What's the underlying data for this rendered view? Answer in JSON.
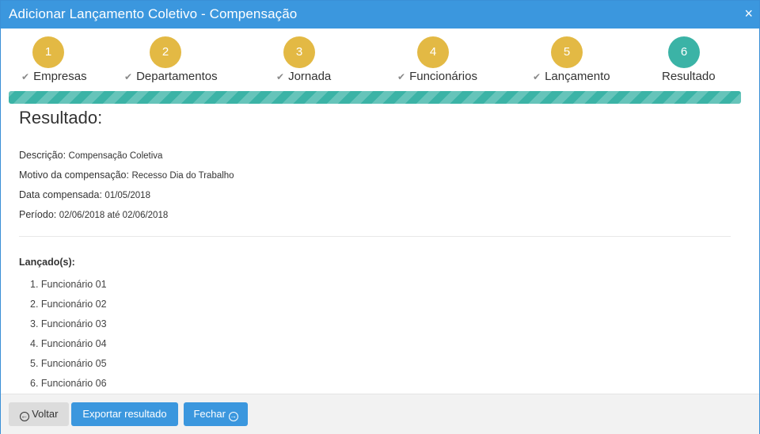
{
  "dialog": {
    "title": "Adicionar Lançamento Coletivo - Compensação",
    "close_glyph": "×"
  },
  "steps": [
    {
      "number": "1",
      "label": "Empresas",
      "completed": true
    },
    {
      "number": "2",
      "label": "Departamentos",
      "completed": true
    },
    {
      "number": "3",
      "label": "Jornada",
      "completed": true
    },
    {
      "number": "4",
      "label": "Funcionários",
      "completed": true
    },
    {
      "number": "5",
      "label": "Lançamento",
      "completed": true
    },
    {
      "number": "6",
      "label": "Resultado",
      "completed": false,
      "active": true
    }
  ],
  "progress": {
    "fraction": 1.0
  },
  "result": {
    "heading": "Resultado:",
    "descricao_label": "Descrição:",
    "descricao_value": "Compensação Coletiva",
    "motivo_label": "Motivo da compensação:",
    "motivo_value": "Recesso Dia do Trabalho",
    "data_label": "Data compensada:",
    "data_value": "01/05/2018",
    "periodo_label": "Período:",
    "periodo_value": "02/06/2018 até 02/06/2018"
  },
  "launched": {
    "title": "Lançado(s):",
    "items": [
      "1. Funcionário 01",
      "2. Funcionário 02",
      "3. Funcionário 03",
      "4. Funcionário 04",
      "5. Funcionário 05",
      "6. Funcionário 06"
    ]
  },
  "footer": {
    "back_label": "Voltar",
    "export_label": "Exportar resultado",
    "close_label": "Fechar"
  },
  "colors": {
    "header": "#3b97de",
    "step_done": "#e3b944",
    "step_active": "#3bb3a6",
    "progress": "#3bb3a6"
  }
}
